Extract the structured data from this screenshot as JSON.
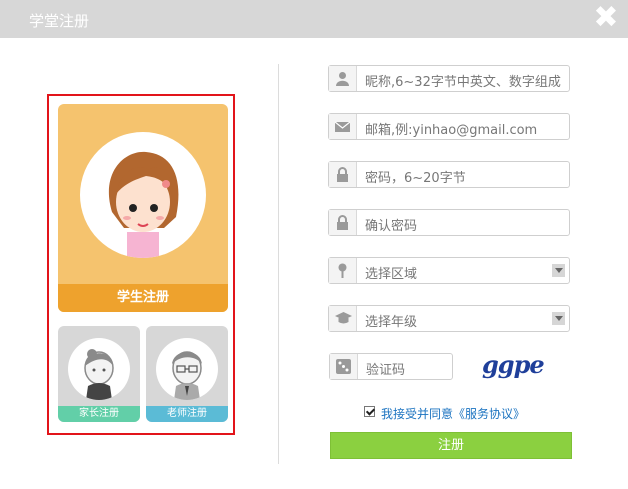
{
  "window": {
    "title": "学堂注册",
    "close_label": "✖"
  },
  "roles": {
    "student": {
      "label": "学生注册"
    },
    "parent": {
      "label": "家长注册"
    },
    "teacher": {
      "label": "老师注册"
    }
  },
  "form": {
    "nickname": {
      "placeholder": "昵称,6~32字节中英文、数字组成"
    },
    "email": {
      "placeholder": "邮箱,例:yinhao@gmail.com"
    },
    "password": {
      "placeholder": "密码，6~20字节"
    },
    "confirm_password": {
      "placeholder": "确认密码"
    },
    "region": {
      "selected": "选择区域"
    },
    "grade": {
      "selected": "选择年级"
    },
    "captcha": {
      "placeholder": "验证码",
      "image_text": "ggpe"
    },
    "agree": {
      "text": "我接受并同意《服务协议》",
      "checked": true
    },
    "submit_label": "注册"
  },
  "colors": {
    "accent": "#eea22d",
    "submit": "#8bd040",
    "selection": "#e2141a",
    "parent": "#62cfa8",
    "teacher": "#5bbbd6"
  }
}
